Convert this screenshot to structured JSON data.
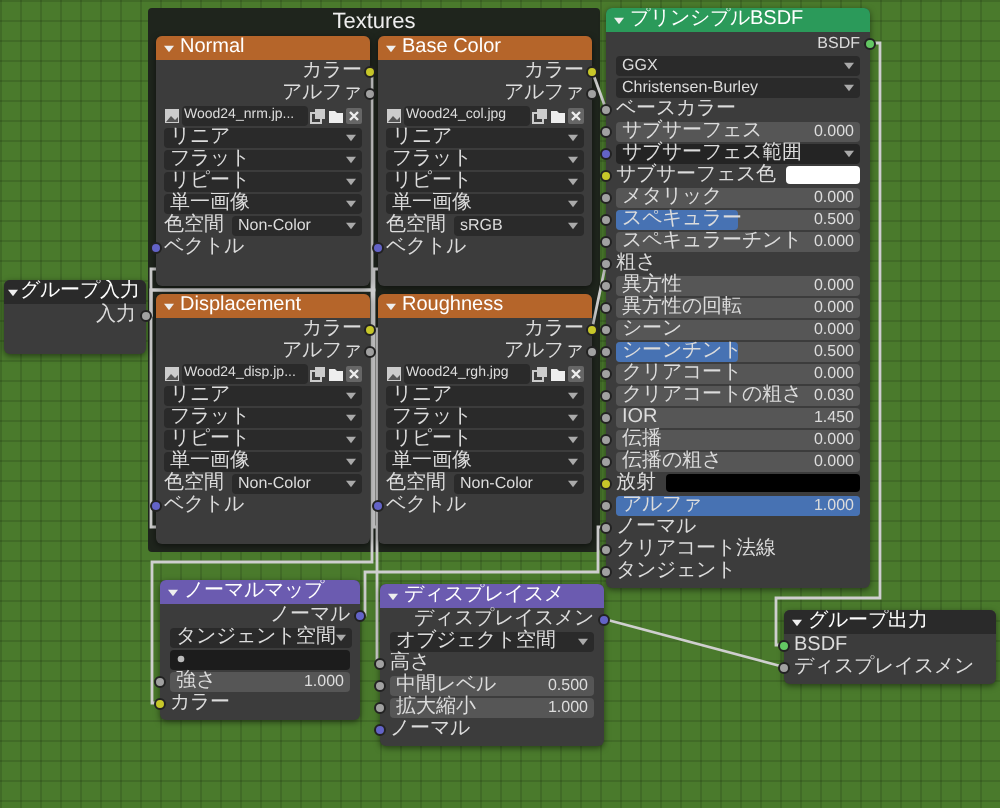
{
  "group_input": {
    "title": "グループ入力",
    "output": "入力"
  },
  "frame": {
    "title": "Textures",
    "nodes": [
      {
        "title": "Normal",
        "outputs": [
          "カラー",
          "アルファ"
        ],
        "image": "Wood24_nrm.jp...",
        "options": [
          "リニア",
          "フラット",
          "リピート",
          "単一画像"
        ],
        "color_space_label": "色空間",
        "color_space": "Non-Color",
        "input": "ベクトル"
      },
      {
        "title": "Displacement",
        "outputs": [
          "カラー",
          "アルファ"
        ],
        "image": "Wood24_disp.jp...",
        "options": [
          "リニア",
          "フラット",
          "リピート",
          "単一画像"
        ],
        "color_space_label": "色空間",
        "color_space": "Non-Color",
        "input": "ベクトル"
      },
      {
        "title": "Base Color",
        "outputs": [
          "カラー",
          "アルファ"
        ],
        "image": "Wood24_col.jpg",
        "options": [
          "リニア",
          "フラット",
          "リピート",
          "単一画像"
        ],
        "color_space_label": "色空間",
        "color_space": "sRGB",
        "input": "ベクトル"
      },
      {
        "title": "Roughness",
        "outputs": [
          "カラー",
          "アルファ"
        ],
        "image": "Wood24_rgh.jpg",
        "options": [
          "リニア",
          "フラット",
          "リピート",
          "単一画像"
        ],
        "color_space_label": "色空間",
        "color_space": "Non-Color",
        "input": "ベクトル"
      }
    ]
  },
  "principled": {
    "title": "プリンシプルBSDF",
    "output": "BSDF",
    "distribution": "GGX",
    "subsurface_method": "Christensen-Burley",
    "inputs": [
      {
        "kind": "link",
        "label": "ベースカラー"
      },
      {
        "kind": "value",
        "label": "サブサーフェス",
        "value": "0.000"
      },
      {
        "kind": "expand",
        "label": "サブサーフェス範囲"
      },
      {
        "kind": "color",
        "label": "サブサーフェス色",
        "color": "#ffffff"
      },
      {
        "kind": "value",
        "label": "メタリック",
        "value": "0.000"
      },
      {
        "kind": "slider",
        "label": "スペキュラー",
        "value": "0.500",
        "level": 0.5
      },
      {
        "kind": "value",
        "label": "スペキュラーチント",
        "value": "0.000"
      },
      {
        "kind": "link",
        "label": "粗さ"
      },
      {
        "kind": "value",
        "label": "異方性",
        "value": "0.000"
      },
      {
        "kind": "value",
        "label": "異方性の回転",
        "value": "0.000"
      },
      {
        "kind": "value",
        "label": "シーン",
        "value": "0.000"
      },
      {
        "kind": "slider",
        "label": "シーンチント",
        "value": "0.500",
        "level": 0.5
      },
      {
        "kind": "value",
        "label": "クリアコート",
        "value": "0.000"
      },
      {
        "kind": "value",
        "label": "クリアコートの粗さ",
        "value": "0.030"
      },
      {
        "kind": "value",
        "label": "IOR",
        "value": "1.450"
      },
      {
        "kind": "value",
        "label": "伝播",
        "value": "0.000"
      },
      {
        "kind": "value",
        "label": "伝播の粗さ",
        "value": "0.000"
      },
      {
        "kind": "color",
        "label": "放射",
        "color": "#000000"
      },
      {
        "kind": "slider",
        "label": "アルファ",
        "value": "1.000",
        "level": 1
      },
      {
        "kind": "link",
        "label": "ノーマル"
      },
      {
        "kind": "link",
        "label": "クリアコート法線"
      },
      {
        "kind": "link",
        "label": "タンジェント"
      }
    ]
  },
  "normal_map": {
    "title": "ノーマルマップ",
    "output": "ノーマル",
    "space": "タンジェント空間",
    "strength_label": "強さ",
    "strength": "1.000",
    "input": "カラー"
  },
  "displacement": {
    "title": "ディスプレイスメ",
    "output": "ディスプレイスメン",
    "space": "オブジェクト空間",
    "inputs": [
      {
        "kind": "link",
        "label": "高さ"
      },
      {
        "kind": "value",
        "label": "中間レベル",
        "value": "0.500"
      },
      {
        "kind": "value",
        "label": "拡大縮小",
        "value": "1.000"
      },
      {
        "kind": "link",
        "label": "ノーマル"
      }
    ]
  },
  "group_output": {
    "title": "グループ出力",
    "inputs": [
      "BSDF",
      "ディスプレイスメン"
    ]
  }
}
